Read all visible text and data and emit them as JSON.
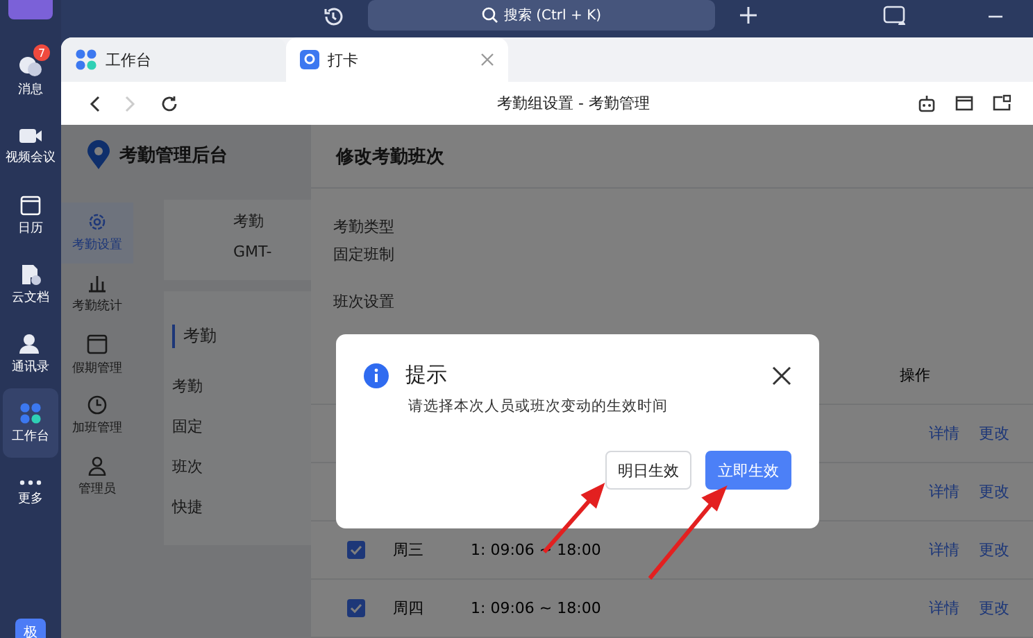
{
  "rail": {
    "items": [
      {
        "label": "消息",
        "badge": "7",
        "selected": false
      },
      {
        "label": "视频会议",
        "selected": false
      },
      {
        "label": "日历",
        "selected": false
      },
      {
        "label": "云文档",
        "selected": false
      },
      {
        "label": "通讯录",
        "selected": false
      },
      {
        "label": "工作台",
        "selected": true
      },
      {
        "label": "更多",
        "selected": false
      }
    ],
    "avatar": "极"
  },
  "topbar": {
    "search": {
      "placeholder": "搜索 (Ctrl + K)"
    }
  },
  "tabs": [
    {
      "label": "工作台",
      "selected": false
    },
    {
      "label": "打卡",
      "selected": true
    }
  ],
  "nav": {
    "title": "考勤组设置 - 考勤管理",
    "forward_disabled": true
  },
  "app": {
    "title": "考勤管理后台",
    "menu": [
      {
        "label": "考勤设置",
        "selected": true
      },
      {
        "label": "考勤统计",
        "selected": false
      },
      {
        "label": "假期管理",
        "selected": false
      },
      {
        "label": "加班管理",
        "selected": false
      },
      {
        "label": "管理员",
        "selected": false
      }
    ],
    "top_texts": [
      "考勤",
      "GMT-"
    ],
    "section_title": "考勤",
    "section_texts": [
      "考勤",
      "固定",
      "班次",
      "快捷"
    ]
  },
  "drawer": {
    "title": "修改考勤班次",
    "fields": [
      {
        "label": "考勤类型",
        "value": "固定班制"
      }
    ],
    "section": "班次设置",
    "column_action": "操作",
    "rows": [
      {
        "detail": "详情",
        "edit": "更改"
      },
      {
        "detail": "详情",
        "edit": "更改"
      },
      {
        "checked": true,
        "day": "周三",
        "time": "1: 09:06 ~ 18:00",
        "detail": "详情",
        "edit": "更改"
      },
      {
        "checked": true,
        "day": "周四",
        "time": "1: 09:06 ~ 18:00",
        "detail": "详情",
        "edit": "更改"
      }
    ]
  },
  "dialog": {
    "title": "提示",
    "message": "请选择本次人员或班次变动的生效时间",
    "buttons": [
      {
        "label": "明日生效",
        "kind": "default"
      },
      {
        "label": "立即生效",
        "kind": "primary"
      }
    ]
  }
}
